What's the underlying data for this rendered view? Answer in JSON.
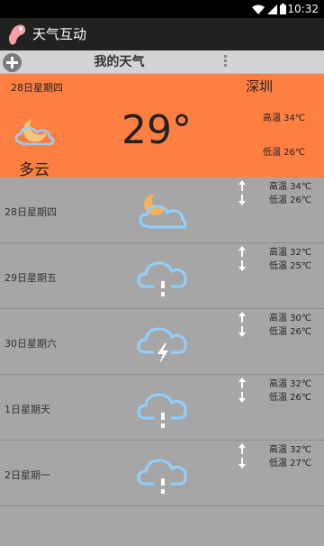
{
  "status_bar": {
    "time": "10:32"
  },
  "app": {
    "title": "天气互动"
  },
  "toolbar": {
    "title": "我的天气"
  },
  "today": {
    "date": "28日星期四",
    "city": "深圳",
    "temperature": "29°",
    "condition": "多云",
    "high": "高温 34℃",
    "low": "低温 26℃",
    "icon": "partly-cloudy-night-icon"
  },
  "forecast": [
    {
      "date": "28日星期四",
      "high": "高温 34℃",
      "low": "低温 26℃",
      "icon": "partly-cloudy-night-icon"
    },
    {
      "date": "29日星期五",
      "high": "高温 32℃",
      "low": "低温 25℃",
      "icon": "rain-cloud-icon"
    },
    {
      "date": "30日星期六",
      "high": "高温 30℃",
      "low": "低温 26℃",
      "icon": "thunder-cloud-icon"
    },
    {
      "date": "1日星期天",
      "high": "高温 32℃",
      "low": "低温 26℃",
      "icon": "rain-cloud-icon"
    },
    {
      "date": "2日星期一",
      "high": "高温 32℃",
      "low": "低温 27℃",
      "icon": "rain-cloud-icon"
    }
  ],
  "colors": {
    "today_bg": "#ff7f40",
    "list_bg": "#a6a6a6",
    "icon_blue": "#8fd0ff",
    "moon": "#f5b25a"
  }
}
